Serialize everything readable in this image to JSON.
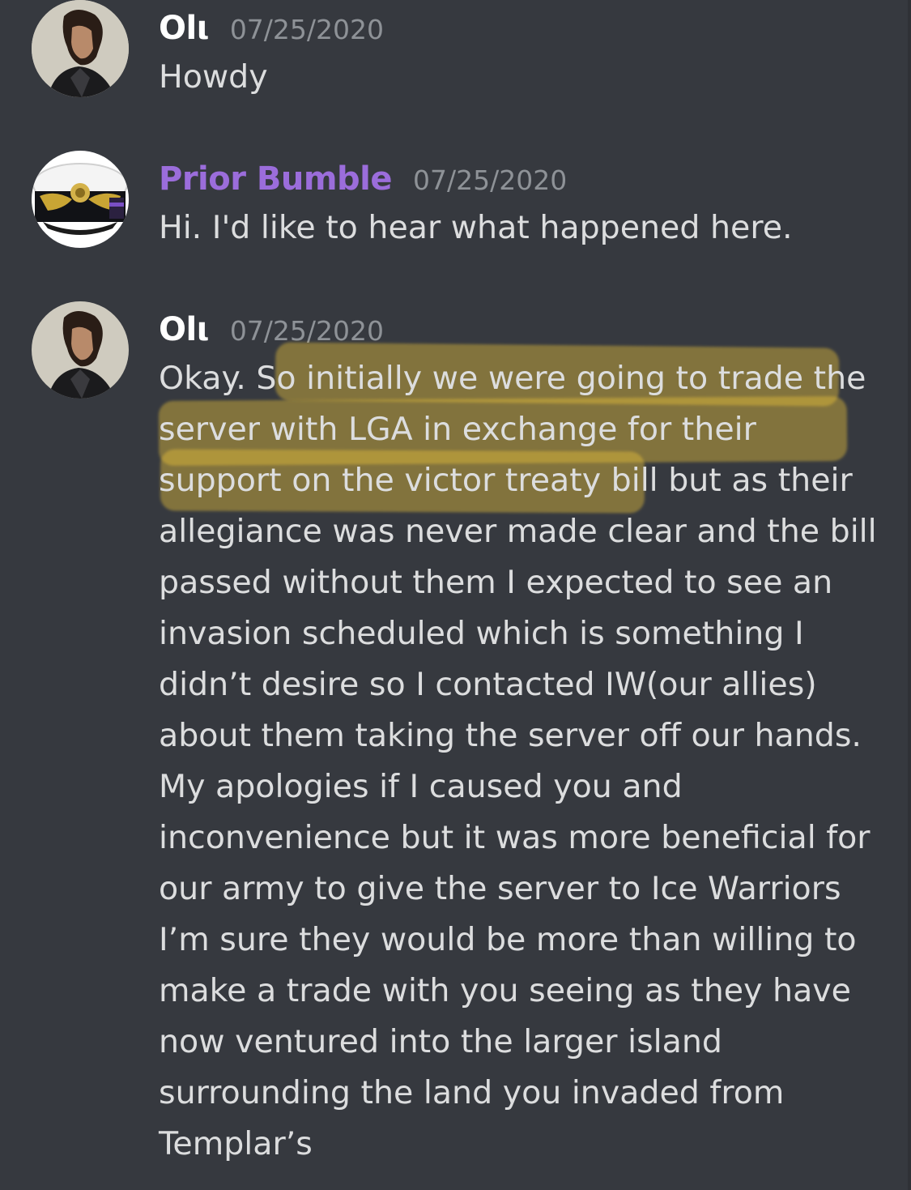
{
  "colors": {
    "background": "#36393f",
    "username_default": "#ffffff",
    "username_role": "#9b6ddb",
    "timestamp": "#8e9297",
    "message_text": "#dcddde",
    "highlight": "#ecc43a"
  },
  "messages": [
    {
      "author": "Olι",
      "timestamp": "07/25/2020",
      "avatar_icon": "man-portrait-avatar",
      "lines": [
        "Howdy"
      ]
    },
    {
      "author": "Prior Bumble",
      "timestamp": "07/25/2020",
      "avatar_icon": "naval-officer-cap-avatar",
      "lines": [
        "Hi. I'd like to hear what happened here."
      ]
    },
    {
      "author": "Olι",
      "timestamp": "07/25/2020",
      "avatar_icon": "man-portrait-avatar",
      "lines": [
        "Okay. So initially we were going to trade the",
        "server with LGA in exchange for their",
        "support on the victor treaty bill but as their",
        "allegiance was never made clear and the bill",
        "passed without them I expected to see an",
        "invasion scheduled which is something I",
        "didn’t desire so I contacted IW(our allies)",
        "about them taking the server off our hands.",
        "My apologies if I caused you and",
        "inconvenience but it was more beneficial for",
        "our army to give the server to Ice Warriors",
        "I’m sure they would be more than willing to",
        "make a trade with you seeing as they have",
        "now ventured into the larger island",
        "surrounding the land you invaded from",
        "Templar’s"
      ]
    }
  ]
}
